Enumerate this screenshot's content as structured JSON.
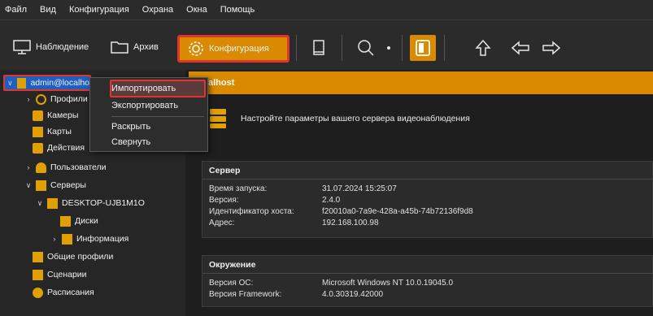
{
  "menu": [
    "Файл",
    "Вид",
    "Конфигурация",
    "Охрана",
    "Окна",
    "Помощь"
  ],
  "toolbar": {
    "observe_label": "Наблюдение",
    "archive_label": "Архив",
    "config_label": "Конфигурация",
    "icons": [
      "book-icon",
      "search-icon",
      "dropdown-arrow-icon",
      "layout-panel-icon",
      "arrow-up-icon",
      "arrow-back-icon",
      "arrow-forward-icon"
    ]
  },
  "tree": {
    "root": "admin@localho",
    "items": [
      {
        "label": "Профили",
        "icon": "target-icon"
      },
      {
        "label": "Камеры",
        "icon": "camera-icon"
      },
      {
        "label": "Карты",
        "icon": "map-icon"
      },
      {
        "label": "Действия",
        "icon": "checkbox-icon"
      },
      {
        "label": "Пользователи",
        "icon": "user-icon"
      },
      {
        "label": "Серверы",
        "icon": "servers-icon"
      },
      {
        "label": "DESKTOP-UJB1M1O",
        "icon": "server-icon"
      },
      {
        "label": "Диски",
        "icon": "disk-icon"
      },
      {
        "label": "Информация",
        "icon": "info-icon"
      },
      {
        "label": "Общие профили",
        "icon": "profile-icon"
      },
      {
        "label": "Сценарии",
        "icon": "script-icon"
      },
      {
        "label": "Расписания",
        "icon": "clock-icon"
      }
    ]
  },
  "context_menu": {
    "items": [
      "Импортировать",
      "Экспортировать",
      "Раскрыть",
      "Свернуть"
    ]
  },
  "content": {
    "header": "alhost",
    "intro": "Настройте параметры вашего сервера видеонаблюдения",
    "server_panel": {
      "title": "Сервер",
      "rows": [
        {
          "k": "Время запуска:",
          "v": "31.07.2024 15:25:07"
        },
        {
          "k": "Версия:",
          "v": "2.4.0"
        },
        {
          "k": "Идентификатор хоста:",
          "v": "f20010a0-7a9e-428a-a45b-74b72136f9d8"
        },
        {
          "k": "Адрес:",
          "v": "192.168.100.98"
        }
      ]
    },
    "env_panel": {
      "title": "Окружение",
      "rows": [
        {
          "k": "Версия ОС:",
          "v": "Microsoft Windows NT 10.0.19045.0"
        },
        {
          "k": "Версия Framework:",
          "v": "4.0.30319.42000"
        }
      ]
    }
  },
  "colors": {
    "accent": "#d98a00",
    "highlight": "#e0352b",
    "selection": "#1f5fbf"
  }
}
